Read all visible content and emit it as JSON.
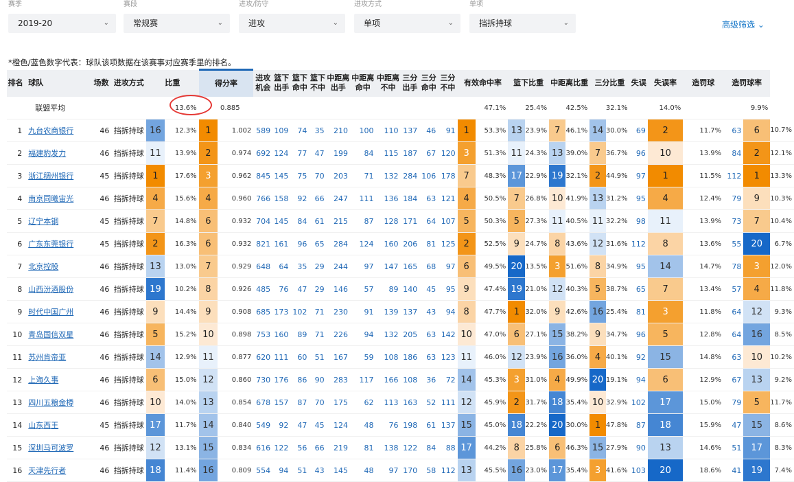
{
  "filters": [
    {
      "label": "赛季",
      "value": "2019-20"
    },
    {
      "label": "赛段",
      "value": "常规赛"
    },
    {
      "label": "进攻/防守",
      "value": "进攻"
    },
    {
      "label": "进攻方式",
      "value": "单项"
    },
    {
      "label": "单项",
      "value": "挡拆持球"
    }
  ],
  "advanced_filter": "高级筛选",
  "note": "*橙色/蓝色数字代表：球队该项数据在该赛事对应赛季里的排名。",
  "headers": {
    "rank": "排名",
    "team": "球队",
    "games": "场数",
    "type": "进攻方式",
    "freq": "比重",
    "ppp": "得分率",
    "poss": [
      "进攻",
      "机会"
    ],
    "fga_in": [
      "篮下",
      "出手"
    ],
    "fgm_in": [
      "篮下",
      "命中"
    ],
    "miss_in": [
      "篮下",
      "不中"
    ],
    "fga_mid": [
      "中距离",
      "出手"
    ],
    "fgm_mid": [
      "中距离",
      "命中"
    ],
    "miss_mid": [
      "中距离",
      "不中"
    ],
    "fga_3": [
      "三分",
      "出手"
    ],
    "fgm_3": [
      "三分",
      "命中"
    ],
    "miss_3": [
      "三分",
      "不中"
    ],
    "efg": "有效命中率",
    "rim_freq": "篮下比重",
    "mid_freq": "中距离比重",
    "three_freq": "三分比重",
    "tov": "失误",
    "tov_rate": "失误率",
    "fouls": "造罚球",
    "foul_rate": "造罚球率"
  },
  "league_avg": {
    "label": "联盟平均",
    "freq": "13.6%",
    "ppp": "0.885",
    "efg": "47.1%",
    "rim_freq": "25.4%",
    "mid_freq": "42.5%",
    "three_freq": "32.1%",
    "tov_rate": "14.0%",
    "foul_rate": "9.9%"
  },
  "rows": [
    {
      "rank": "1",
      "team": "九台农商银行",
      "games": "46",
      "type": "挡拆持球",
      "freq_rk": "16",
      "freq": "12.3%",
      "ppp_rk": "1",
      "ppp": "1.002",
      "poss": "589",
      "fga_in": "109",
      "fgm_in": "74",
      "miss_in": "35",
      "fga_mid": "210",
      "fgm_mid": "100",
      "miss_mid": "110",
      "fga_3": "137",
      "fgm_3": "46",
      "miss_3": "91",
      "efg_rk": "1",
      "efg": "53.3%",
      "rim_rk": "13",
      "rim": "23.9%",
      "mid_rk": "7",
      "mid": "46.1%",
      "three_rk": "14",
      "three": "30.0%",
      "tov": "69",
      "tovr_rk": "2",
      "tovr": "11.7%",
      "fouls": "63",
      "fr_rk": "6",
      "fr": "10.7%"
    },
    {
      "rank": "2",
      "team": "福建豹发力",
      "games": "46",
      "type": "挡拆持球",
      "freq_rk": "11",
      "freq": "13.9%",
      "ppp_rk": "2",
      "ppp": "0.974",
      "poss": "692",
      "fga_in": "124",
      "fgm_in": "77",
      "miss_in": "47",
      "fga_mid": "199",
      "fgm_mid": "84",
      "miss_mid": "115",
      "fga_3": "187",
      "fgm_3": "67",
      "miss_3": "120",
      "efg_rk": "3",
      "efg": "51.3%",
      "rim_rk": "11",
      "rim": "24.3%",
      "mid_rk": "13",
      "mid": "39.0%",
      "three_rk": "7",
      "three": "36.7%",
      "tov": "96",
      "tovr_rk": "10",
      "tovr": "13.9%",
      "fouls": "84",
      "fr_rk": "2",
      "fr": "12.1%"
    },
    {
      "rank": "3",
      "team": "浙江稠州银行",
      "games": "45",
      "type": "挡拆持球",
      "freq_rk": "1",
      "freq": "17.6%",
      "ppp_rk": "3",
      "ppp": "0.962",
      "poss": "845",
      "fga_in": "145",
      "fgm_in": "75",
      "miss_in": "70",
      "fga_mid": "203",
      "fgm_mid": "71",
      "miss_mid": "132",
      "fga_3": "284",
      "fgm_3": "106",
      "miss_3": "178",
      "efg_rk": "7",
      "efg": "48.3%",
      "rim_rk": "17",
      "rim": "22.9%",
      "mid_rk": "19",
      "mid": "32.1%",
      "three_rk": "2",
      "three": "44.9%",
      "tov": "97",
      "tovr_rk": "1",
      "tovr": "11.5%",
      "fouls": "112",
      "fr_rk": "1",
      "fr": "13.3%"
    },
    {
      "rank": "4",
      "team": "南京同曦宙光",
      "games": "46",
      "type": "挡拆持球",
      "freq_rk": "4",
      "freq": "15.6%",
      "ppp_rk": "4",
      "ppp": "0.960",
      "poss": "766",
      "fga_in": "158",
      "fgm_in": "92",
      "miss_in": "66",
      "fga_mid": "247",
      "fgm_mid": "111",
      "miss_mid": "136",
      "fga_3": "184",
      "fgm_3": "63",
      "miss_3": "121",
      "efg_rk": "4",
      "efg": "50.5%",
      "rim_rk": "7",
      "rim": "26.8%",
      "mid_rk": "10",
      "mid": "41.9%",
      "three_rk": "13",
      "three": "31.2%",
      "tov": "95",
      "tovr_rk": "4",
      "tovr": "12.4%",
      "fouls": "79",
      "fr_rk": "9",
      "fr": "10.3%"
    },
    {
      "rank": "5",
      "team": "辽宁本钢",
      "games": "45",
      "type": "挡拆持球",
      "freq_rk": "7",
      "freq": "14.8%",
      "ppp_rk": "6",
      "ppp": "0.932",
      "poss": "704",
      "fga_in": "145",
      "fgm_in": "84",
      "miss_in": "61",
      "fga_mid": "215",
      "fgm_mid": "87",
      "miss_mid": "128",
      "fga_3": "171",
      "fgm_3": "64",
      "miss_3": "107",
      "efg_rk": "5",
      "efg": "50.3%",
      "rim_rk": "5",
      "rim": "27.3%",
      "mid_rk": "11",
      "mid": "40.5%",
      "three_rk": "11",
      "three": "32.2%",
      "tov": "98",
      "tovr_rk": "11",
      "tovr": "13.9%",
      "fouls": "73",
      "fr_rk": "7",
      "fr": "10.4%"
    },
    {
      "rank": "6",
      "team": "广东东莞银行",
      "games": "45",
      "type": "挡拆持球",
      "freq_rk": "2",
      "freq": "16.3%",
      "ppp_rk": "6",
      "ppp": "0.932",
      "poss": "821",
      "fga_in": "161",
      "fgm_in": "96",
      "miss_in": "65",
      "fga_mid": "284",
      "fgm_mid": "124",
      "miss_mid": "160",
      "fga_3": "206",
      "fgm_3": "81",
      "miss_3": "125",
      "efg_rk": "2",
      "efg": "52.5%",
      "rim_rk": "9",
      "rim": "24.7%",
      "mid_rk": "8",
      "mid": "43.6%",
      "three_rk": "12",
      "three": "31.6%",
      "tov": "112",
      "tovr_rk": "8",
      "tovr": "13.6%",
      "fouls": "55",
      "fr_rk": "20",
      "fr": "6.7%"
    },
    {
      "rank": "7",
      "team": "北京控股",
      "games": "46",
      "type": "挡拆持球",
      "freq_rk": "13",
      "freq": "13.0%",
      "ppp_rk": "7",
      "ppp": "0.929",
      "poss": "648",
      "fga_in": "64",
      "fgm_in": "35",
      "miss_in": "29",
      "fga_mid": "244",
      "fgm_mid": "97",
      "miss_mid": "147",
      "fga_3": "165",
      "fgm_3": "68",
      "miss_3": "97",
      "efg_rk": "6",
      "efg": "49.5%",
      "rim_rk": "20",
      "rim": "13.5%",
      "mid_rk": "3",
      "mid": "51.6%",
      "three_rk": "8",
      "three": "34.9%",
      "tov": "95",
      "tovr_rk": "14",
      "tovr": "14.7%",
      "fouls": "78",
      "fr_rk": "3",
      "fr": "12.0%"
    },
    {
      "rank": "8",
      "team": "山西汾酒股份",
      "games": "46",
      "type": "挡拆持球",
      "freq_rk": "19",
      "freq": "10.2%",
      "ppp_rk": "8",
      "ppp": "0.926",
      "poss": "485",
      "fga_in": "76",
      "fgm_in": "47",
      "miss_in": "29",
      "fga_mid": "146",
      "fgm_mid": "57",
      "miss_mid": "89",
      "fga_3": "140",
      "fgm_3": "45",
      "miss_3": "95",
      "efg_rk": "9",
      "efg": "47.4%",
      "rim_rk": "19",
      "rim": "21.0%",
      "mid_rk": "12",
      "mid": "40.3%",
      "three_rk": "5",
      "three": "38.7%",
      "tov": "65",
      "tovr_rk": "7",
      "tovr": "13.4%",
      "fouls": "57",
      "fr_rk": "4",
      "fr": "11.8%"
    },
    {
      "rank": "9",
      "team": "时代中国广州",
      "games": "46",
      "type": "挡拆持球",
      "freq_rk": "9",
      "freq": "14.4%",
      "ppp_rk": "9",
      "ppp": "0.908",
      "poss": "685",
      "fga_in": "173",
      "fgm_in": "102",
      "miss_in": "71",
      "fga_mid": "230",
      "fgm_mid": "91",
      "miss_mid": "139",
      "fga_3": "137",
      "fgm_3": "43",
      "miss_3": "94",
      "efg_rk": "8",
      "efg": "47.7%",
      "rim_rk": "1",
      "rim": "32.0%",
      "mid_rk": "9",
      "mid": "42.6%",
      "three_rk": "16",
      "three": "25.4%",
      "tov": "81",
      "tovr_rk": "3",
      "tovr": "11.8%",
      "fouls": "64",
      "fr_rk": "12",
      "fr": "9.3%"
    },
    {
      "rank": "10",
      "team": "青岛国信双星",
      "games": "46",
      "type": "挡拆持球",
      "freq_rk": "5",
      "freq": "15.2%",
      "ppp_rk": "10",
      "ppp": "0.898",
      "poss": "753",
      "fga_in": "160",
      "fgm_in": "89",
      "miss_in": "71",
      "fga_mid": "226",
      "fgm_mid": "94",
      "miss_mid": "132",
      "fga_3": "205",
      "fgm_3": "63",
      "miss_3": "142",
      "efg_rk": "10",
      "efg": "47.0%",
      "rim_rk": "6",
      "rim": "27.1%",
      "mid_rk": "15",
      "mid": "38.2%",
      "three_rk": "9",
      "three": "34.7%",
      "tov": "96",
      "tovr_rk": "5",
      "tovr": "12.8%",
      "fouls": "64",
      "fr_rk": "16",
      "fr": "8.5%"
    },
    {
      "rank": "11",
      "team": "苏州肯帝亚",
      "games": "46",
      "type": "挡拆持球",
      "freq_rk": "14",
      "freq": "12.9%",
      "ppp_rk": "11",
      "ppp": "0.877",
      "poss": "620",
      "fga_in": "111",
      "fgm_in": "60",
      "miss_in": "51",
      "fga_mid": "167",
      "fgm_mid": "59",
      "miss_mid": "108",
      "fga_3": "186",
      "fgm_3": "63",
      "miss_3": "123",
      "efg_rk": "11",
      "efg": "46.0%",
      "rim_rk": "12",
      "rim": "23.9%",
      "mid_rk": "16",
      "mid": "36.0%",
      "three_rk": "4",
      "three": "40.1%",
      "tov": "92",
      "tovr_rk": "15",
      "tovr": "14.8%",
      "fouls": "63",
      "fr_rk": "10",
      "fr": "10.2%"
    },
    {
      "rank": "12",
      "team": "上海久事",
      "games": "46",
      "type": "挡拆持球",
      "freq_rk": "6",
      "freq": "15.0%",
      "ppp_rk": "12",
      "ppp": "0.860",
      "poss": "730",
      "fga_in": "176",
      "fgm_in": "86",
      "miss_in": "90",
      "fga_mid": "283",
      "fgm_mid": "117",
      "miss_mid": "166",
      "fga_3": "108",
      "fgm_3": "36",
      "miss_3": "72",
      "efg_rk": "14",
      "efg": "45.3%",
      "rim_rk": "3",
      "rim": "31.0%",
      "mid_rk": "4",
      "mid": "49.9%",
      "three_rk": "20",
      "three": "19.1%",
      "tov": "94",
      "tovr_rk": "6",
      "tovr": "12.9%",
      "fouls": "67",
      "fr_rk": "13",
      "fr": "9.2%"
    },
    {
      "rank": "13",
      "team": "四川五粮金樽",
      "games": "46",
      "type": "挡拆持球",
      "freq_rk": "10",
      "freq": "14.0%",
      "ppp_rk": "13",
      "ppp": "0.854",
      "poss": "678",
      "fga_in": "157",
      "fgm_in": "87",
      "miss_in": "70",
      "fga_mid": "175",
      "fgm_mid": "62",
      "miss_mid": "113",
      "fga_3": "163",
      "fgm_3": "52",
      "miss_3": "111",
      "efg_rk": "12",
      "efg": "45.9%",
      "rim_rk": "2",
      "rim": "31.7%",
      "mid_rk": "18",
      "mid": "35.4%",
      "three_rk": "10",
      "three": "32.9%",
      "tov": "102",
      "tovr_rk": "17",
      "tovr": "15.0%",
      "fouls": "79",
      "fr_rk": "5",
      "fr": "11.7%"
    },
    {
      "rank": "14",
      "team": "山东西王",
      "games": "45",
      "type": "挡拆持球",
      "freq_rk": "17",
      "freq": "11.7%",
      "ppp_rk": "14",
      "ppp": "0.840",
      "poss": "549",
      "fga_in": "92",
      "fgm_in": "47",
      "miss_in": "45",
      "fga_mid": "124",
      "fgm_mid": "48",
      "miss_mid": "76",
      "fga_3": "198",
      "fgm_3": "61",
      "miss_3": "137",
      "efg_rk": "15",
      "efg": "45.0%",
      "rim_rk": "18",
      "rim": "22.2%",
      "mid_rk": "20",
      "mid": "30.0%",
      "three_rk": "1",
      "three": "47.8%",
      "tov": "87",
      "tovr_rk": "18",
      "tovr": "15.9%",
      "fouls": "47",
      "fr_rk": "15",
      "fr": "8.6%"
    },
    {
      "rank": "15",
      "team": "深圳马可波罗",
      "games": "46",
      "type": "挡拆持球",
      "freq_rk": "12",
      "freq": "13.1%",
      "ppp_rk": "15",
      "ppp": "0.834",
      "poss": "616",
      "fga_in": "122",
      "fgm_in": "56",
      "miss_in": "66",
      "fga_mid": "219",
      "fgm_mid": "81",
      "miss_mid": "138",
      "fga_3": "122",
      "fgm_3": "84",
      "miss_3": "88",
      "efg_rk": "17",
      "efg": "44.2%",
      "rim_rk": "8",
      "rim": "25.8%",
      "mid_rk": "6",
      "mid": "46.3%",
      "three_rk": "15",
      "three": "27.9%",
      "tov": "90",
      "tovr_rk": "13",
      "tovr": "14.6%",
      "fouls": "51",
      "fr_rk": "17",
      "fr": "8.3%"
    },
    {
      "rank": "16",
      "team": "天津先行者",
      "games": "46",
      "type": "挡拆持球",
      "freq_rk": "18",
      "freq": "11.4%",
      "ppp_rk": "16",
      "ppp": "0.809",
      "poss": "554",
      "fga_in": "94",
      "fgm_in": "51",
      "miss_in": "43",
      "fga_mid": "145",
      "fgm_mid": "48",
      "miss_mid": "97",
      "fga_3": "170",
      "fgm_3": "58",
      "miss_3": "112",
      "efg_rk": "13",
      "efg": "45.5%",
      "rim_rk": "16",
      "rim": "23.0%",
      "mid_rk": "17",
      "mid": "35.4%",
      "three_rk": "3",
      "three": "41.6%",
      "tov": "103",
      "tovr_rk": "20",
      "tovr": "18.6%",
      "fouls": "41",
      "fr_rk": "19",
      "fr": "7.4%"
    }
  ],
  "colors": {
    "orange_top": "#f28b00",
    "orange_light": "#fde9d4",
    "blue_top": "#1668c8",
    "blue_light": "#e8f1fb",
    "link": "#1f68b6",
    "sorted_header": "#d9e4f1",
    "circle": "#e53935"
  }
}
